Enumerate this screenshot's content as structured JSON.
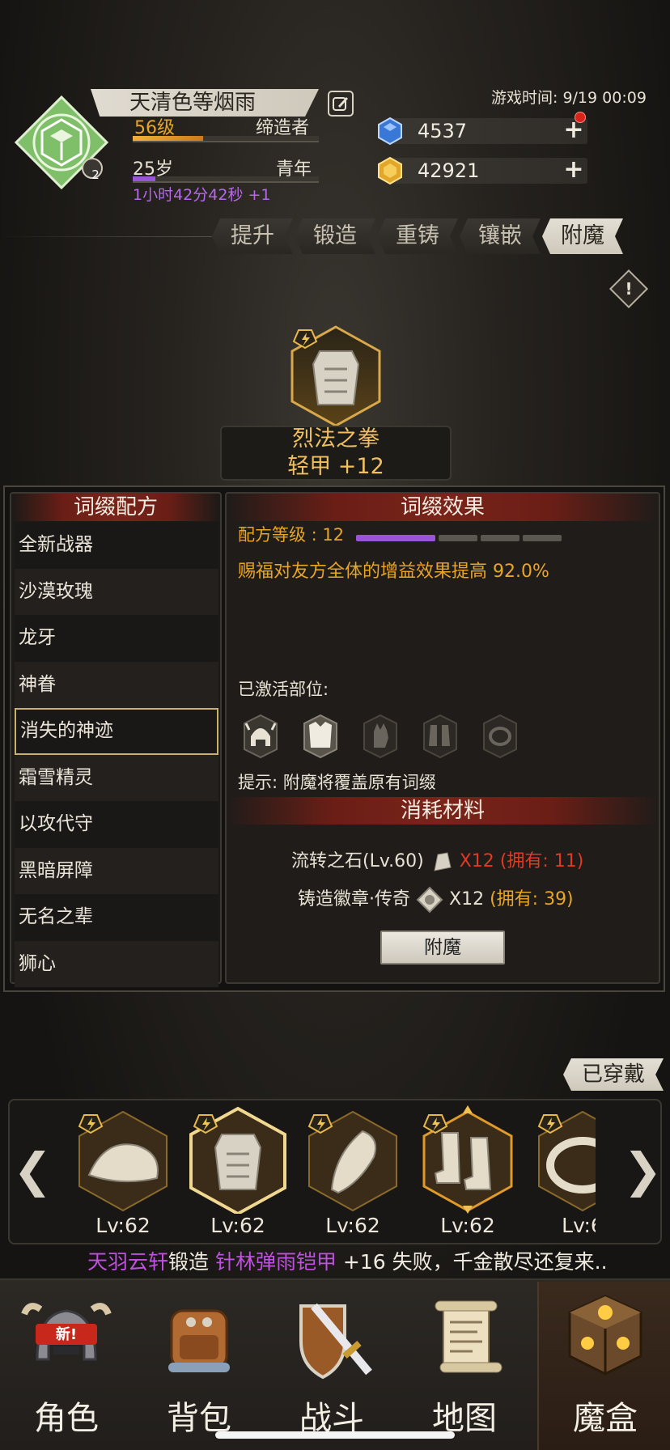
{
  "player": {
    "name": "天清色等烟雨",
    "level": "56级",
    "class": "缔造者",
    "level_progress": 0.38,
    "age": "25岁",
    "age_stage": "青年",
    "age_progress": 0.12,
    "age_timer": "1小时42分42秒 +1",
    "rank_badge": "2"
  },
  "game_time": "游戏时间: 9/19 00:09",
  "currency": {
    "gems": "4537",
    "gold": "42921"
  },
  "tabs": [
    "提升",
    "锻造",
    "重铸",
    "镶嵌",
    "附魔"
  ],
  "active_tab": "附魔",
  "item": {
    "name": "烈法之拳",
    "subtitle": "轻甲 +12"
  },
  "recipe_panel": {
    "title": "词缀配方",
    "items": [
      "全新战器",
      "沙漠玫瑰",
      "龙牙",
      "神眷",
      "消失的神迹",
      "霜雪精灵",
      "以攻代守",
      "黑暗屏障",
      "无名之辈",
      "狮心"
    ],
    "selected": "消失的神迹"
  },
  "effect_panel": {
    "title": "词缀效果",
    "recipe_level": "配方等级 : 12",
    "level_segments_filled": 1,
    "level_segments_total": 4,
    "effect_text": "赐福对友方全体的增益效果提高 92.0%",
    "activated_label": "已激活部位:",
    "slot_icons": [
      "helmet-icon",
      "armor-icon",
      "glove-icon",
      "boots-icon",
      "ring-icon"
    ],
    "tip": "提示: 附魔将覆盖原有词缀"
  },
  "materials": {
    "title": "消耗材料",
    "m1_name": "流转之石(Lv.60)",
    "m1_qty": "X12",
    "m1_own": "(拥有: 11)",
    "m2_name": "铸造徽章·传奇",
    "m2_qty": "X12",
    "m2_own": "(拥有: 39)",
    "button": "附魔"
  },
  "equipped": {
    "label": "已穿戴",
    "slots": [
      {
        "icon": "hat-icon",
        "level": "Lv:62"
      },
      {
        "icon": "armor-icon",
        "level": "Lv:62"
      },
      {
        "icon": "glove-icon",
        "level": "Lv:62"
      },
      {
        "icon": "boots-icon",
        "level": "Lv:62"
      },
      {
        "icon": "ring-icon",
        "level": "Lv:6"
      }
    ]
  },
  "news": {
    "player": "天羽云轩",
    "action": "锻造 ",
    "item": "针林弹雨铠甲",
    "result": " +16 失败，千金散尽还复来.."
  },
  "nav": {
    "items": [
      "角色",
      "背包",
      "战斗",
      "地图",
      "魔盒"
    ],
    "active": "魔盒",
    "new_badge": "新!"
  },
  "colors": {
    "accent_gold": "#e8a526",
    "purple": "#9a55d6",
    "panel_red": "#7a241a",
    "warning_red": "#e03a24"
  }
}
